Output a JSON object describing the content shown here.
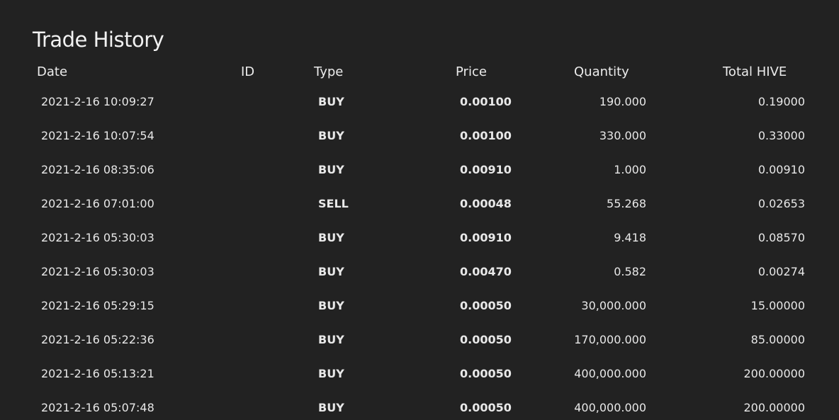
{
  "title": "Trade History",
  "columns": {
    "date": "Date",
    "id": "ID",
    "type": "Type",
    "price": "Price",
    "quantity": "Quantity",
    "total": "Total HIVE"
  },
  "rows": [
    {
      "date": "2021-2-16 10:09:27",
      "type": "BUY",
      "price": "0.00100",
      "quantity": "190.000",
      "total": "0.19000"
    },
    {
      "date": "2021-2-16 10:07:54",
      "type": "BUY",
      "price": "0.00100",
      "quantity": "330.000",
      "total": "0.33000"
    },
    {
      "date": "2021-2-16 08:35:06",
      "type": "BUY",
      "price": "0.00910",
      "quantity": "1.000",
      "total": "0.00910"
    },
    {
      "date": "2021-2-16 07:01:00",
      "type": "SELL",
      "price": "0.00048",
      "quantity": "55.268",
      "total": "0.02653"
    },
    {
      "date": "2021-2-16 05:30:03",
      "type": "BUY",
      "price": "0.00910",
      "quantity": "9.418",
      "total": "0.08570"
    },
    {
      "date": "2021-2-16 05:30:03",
      "type": "BUY",
      "price": "0.00470",
      "quantity": "0.582",
      "total": "0.00274"
    },
    {
      "date": "2021-2-16 05:29:15",
      "type": "BUY",
      "price": "0.00050",
      "quantity": "30,000.000",
      "total": "15.00000"
    },
    {
      "date": "2021-2-16 05:22:36",
      "type": "BUY",
      "price": "0.00050",
      "quantity": "170,000.000",
      "total": "85.00000"
    },
    {
      "date": "2021-2-16 05:13:21",
      "type": "BUY",
      "price": "0.00050",
      "quantity": "400,000.000",
      "total": "200.00000"
    },
    {
      "date": "2021-2-16 05:07:48",
      "type": "BUY",
      "price": "0.00050",
      "quantity": "400,000.000",
      "total": "200.00000"
    }
  ]
}
